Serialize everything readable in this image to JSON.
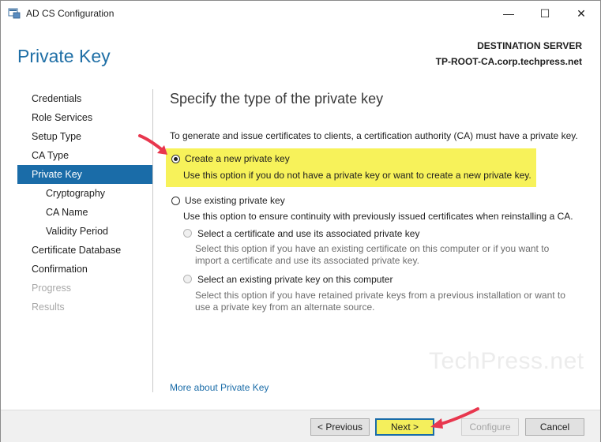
{
  "window": {
    "title": "AD CS Configuration",
    "minimize_glyph": "—",
    "maximize_glyph": "☐",
    "close_glyph": "✕"
  },
  "header": {
    "page_title": "Private Key",
    "destination_label": "DESTINATION SERVER",
    "destination_server": "TP-ROOT-CA.corp.techpress.net"
  },
  "sidebar": {
    "items": [
      {
        "label": "Credentials"
      },
      {
        "label": "Role Services"
      },
      {
        "label": "Setup Type"
      },
      {
        "label": "CA Type"
      },
      {
        "label": "Private Key"
      },
      {
        "label": "Cryptography"
      },
      {
        "label": "CA Name"
      },
      {
        "label": "Validity Period"
      },
      {
        "label": "Certificate Database"
      },
      {
        "label": "Confirmation"
      },
      {
        "label": "Progress"
      },
      {
        "label": "Results"
      }
    ]
  },
  "main": {
    "heading": "Specify the type of the private key",
    "intro": "To generate and issue certificates to clients, a certification authority (CA) must have a private key.",
    "option_new": {
      "label": "Create a new private key",
      "description": "Use this option if you do not have a private key or want to create a new private key.",
      "selected": true
    },
    "option_existing": {
      "label": "Use existing private key",
      "description": "Use this option to ensure continuity with previously issued certificates when reinstalling a CA.",
      "selected": false
    },
    "sub_option_certificate": {
      "label": "Select a certificate and use its associated private key",
      "description_line1": "Select this option if you have an existing certificate on this computer or if you want to",
      "description_line2": "import a certificate and use its associated private key."
    },
    "sub_option_key": {
      "label": "Select an existing private key on this computer",
      "description_line1": "Select this option if you have retained private keys from a previous installation or want to",
      "description_line2": "use a private key from an alternate source."
    },
    "more_link": "More about Private Key",
    "watermark": "TechPress.net"
  },
  "footer": {
    "previous": "< Previous",
    "next": "Next >",
    "configure": "Configure",
    "cancel": "Cancel"
  },
  "colors": {
    "accent": "#1a6ca8",
    "title_blue": "#1f6fa6",
    "highlight": "#f7f25a",
    "arrow": "#e8374e"
  },
  "icons": [
    "app-icon",
    "minimize-icon",
    "maximize-icon",
    "close-icon",
    "arrow-annotation-icon"
  ]
}
